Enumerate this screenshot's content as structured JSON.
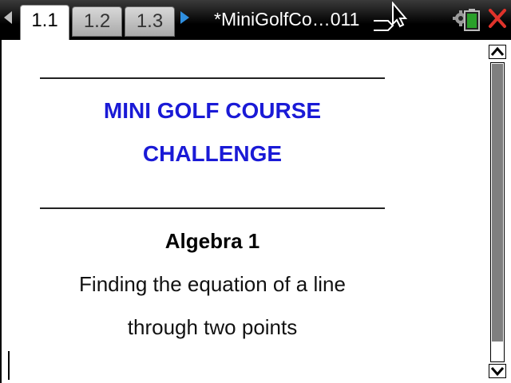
{
  "topbar": {
    "tabs": [
      {
        "label": "1.1",
        "active": true
      },
      {
        "label": "1.2",
        "active": false
      },
      {
        "label": "1.3",
        "active": false
      }
    ],
    "document_title": "*MiniGolfCo…011",
    "icons": [
      "left-arrow-icon",
      "right-arrow-icon",
      "cursor-icon",
      "gear-icon",
      "battery-icon",
      "close-icon"
    ],
    "colors": {
      "next_arrow": "#2f8fe0",
      "battery": "#2aa02a",
      "close": "#e0332b"
    }
  },
  "content": {
    "title_line1": "MINI GOLF COURSE",
    "title_line2": "CHALLENGE",
    "subject": "Algebra 1",
    "description_line1": "Finding the equation of a line",
    "description_line2": "through two points",
    "colors": {
      "title": "#1a1ad6"
    }
  },
  "scrollbar": {
    "visible": true
  }
}
